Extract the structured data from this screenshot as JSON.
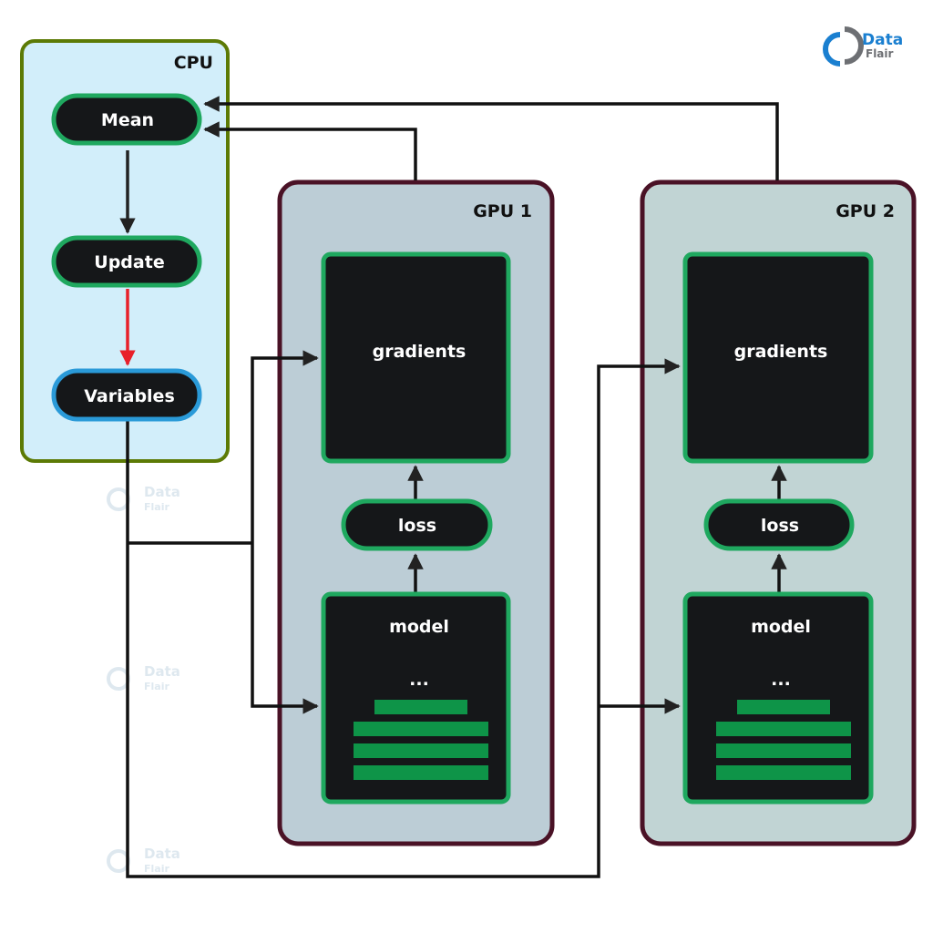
{
  "logo": {
    "line1": "Data",
    "line2": "Flair"
  },
  "watermark": {
    "line1": "Data",
    "line2": "Flair"
  },
  "colors": {
    "cpu_border": "#5c7a05",
    "cpu_fill": "#d2eefa",
    "gpu_border": "#4a1226",
    "gpu1_fill": "#bccdd6",
    "gpu2_fill": "#c1d4d4",
    "node_fill": "#151719",
    "node_border_green": "#1fa85f",
    "node_border_blue": "#2a9ad8",
    "layer_green": "#0e9448",
    "update_arrow": "#e8202a",
    "connector": "#111111",
    "logo_blue": "#1a7fd0",
    "logo_gray": "#6d6f73"
  },
  "cpu": {
    "title": "CPU",
    "nodes": [
      {
        "label": "Mean"
      },
      {
        "label": "Update"
      },
      {
        "label": "Variables"
      }
    ]
  },
  "gpus": [
    {
      "title": "GPU 1",
      "gradients": "gradients",
      "loss": "loss",
      "model": "model",
      "ellipsis": "..."
    },
    {
      "title": "GPU 2",
      "gradients": "gradients",
      "loss": "loss",
      "model": "model",
      "ellipsis": "..."
    }
  ]
}
